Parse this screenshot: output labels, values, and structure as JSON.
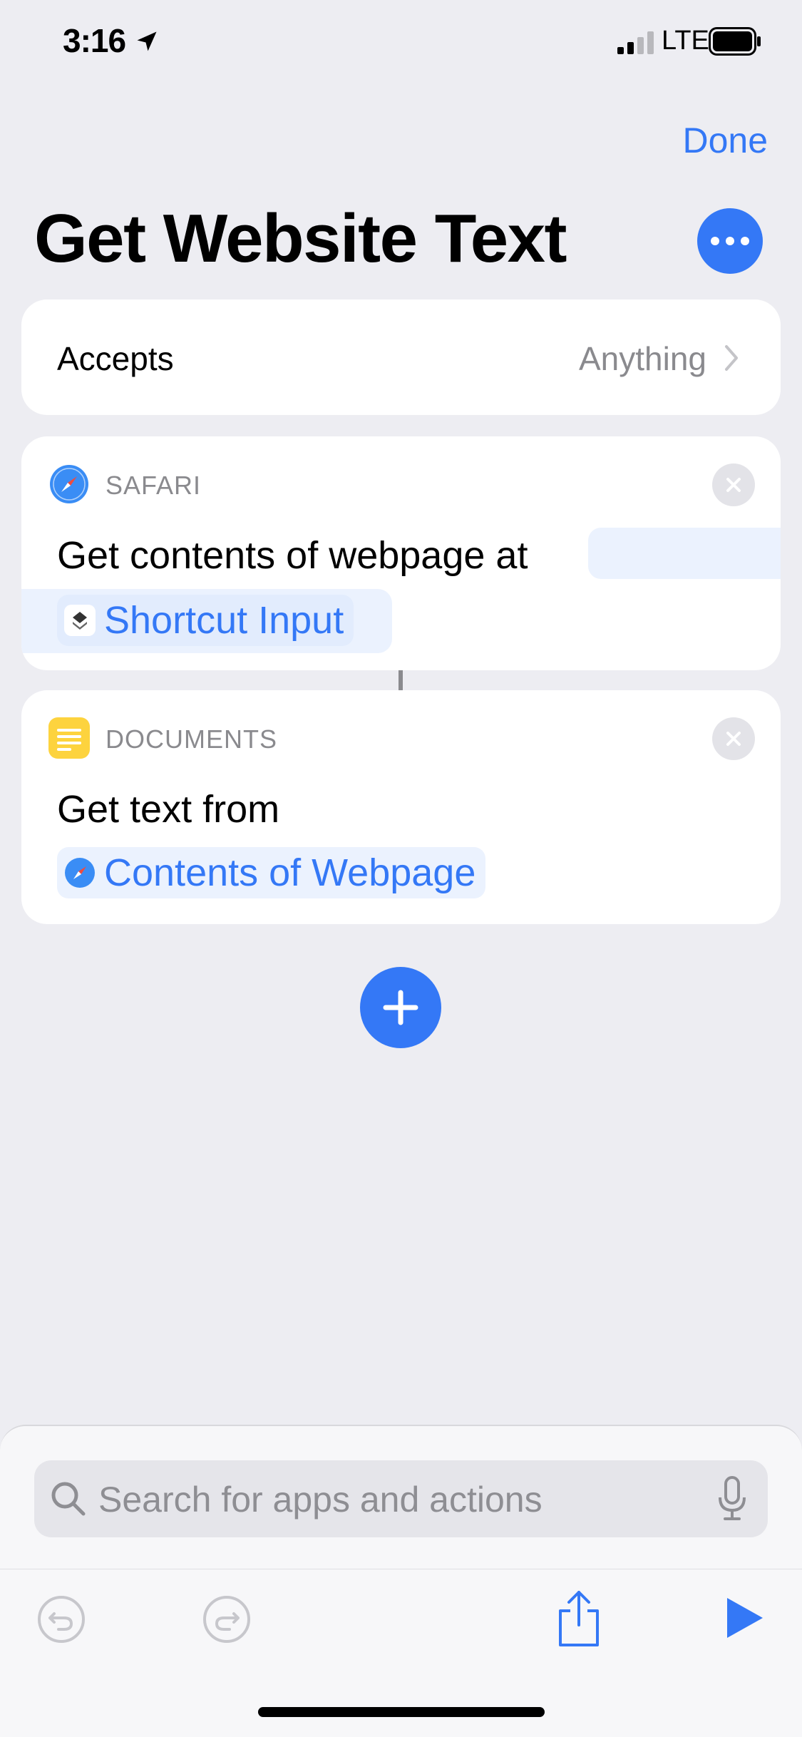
{
  "status_bar": {
    "time": "3:16",
    "network": "LTE",
    "icons": [
      "location-arrow-icon",
      "signal-icon",
      "battery-icon"
    ]
  },
  "header": {
    "done_label": "Done",
    "title": "Get Website Text",
    "more_icon": "ellipsis-icon"
  },
  "accepts": {
    "label": "Accepts",
    "value": "Anything"
  },
  "actions": [
    {
      "app": "SAFARI",
      "app_icon": "safari-compass-icon",
      "text": "Get contents of webpage at",
      "parameter": "Shortcut Input",
      "parameter_icon": "shortcuts-layers-icon"
    },
    {
      "app": "DOCUMENTS",
      "app_icon": "documents-icon",
      "text": "Get text from",
      "parameter": "Contents of Webpage",
      "parameter_icon": "safari-compass-icon"
    }
  ],
  "search": {
    "placeholder": "Search for apps and actions"
  },
  "colors": {
    "accent": "#3478F6",
    "background": "#EDEDF2",
    "documents_yellow": "#FDD33E",
    "secondary_text": "#8A8A8E"
  }
}
